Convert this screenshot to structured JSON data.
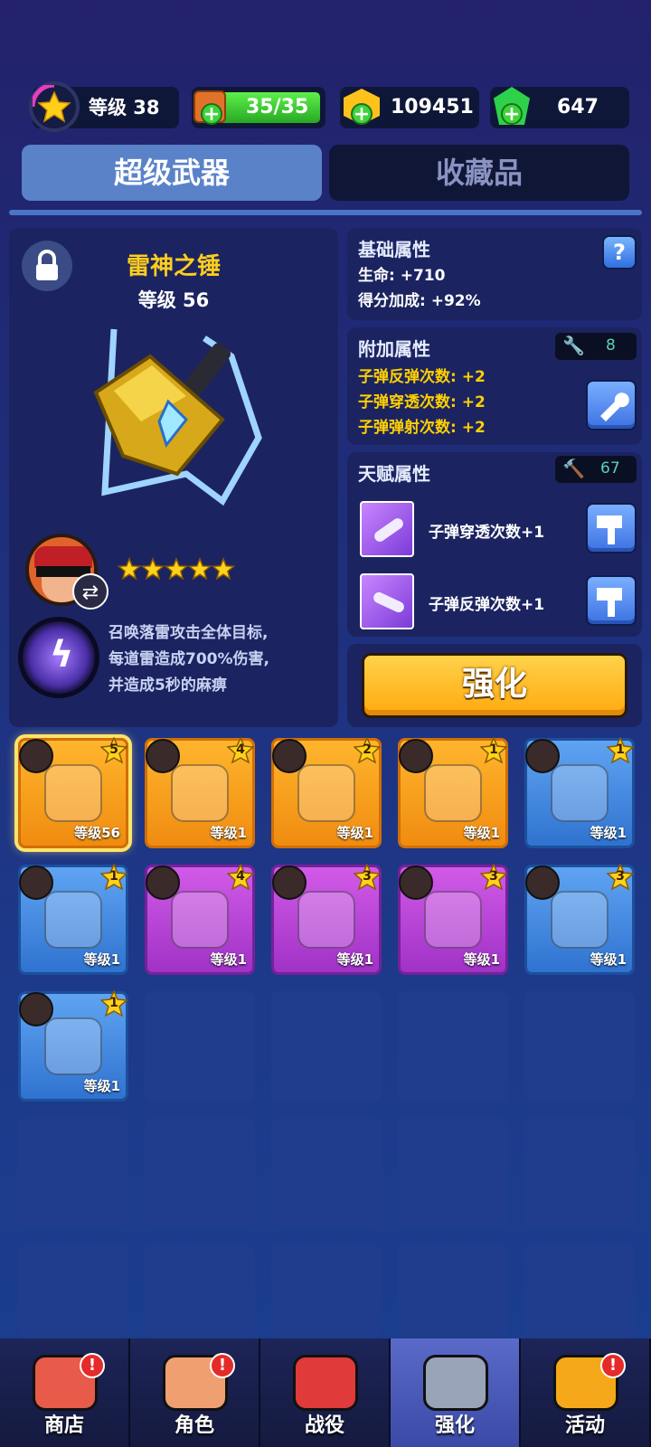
{
  "top_bar": {
    "level_label": "等级 38",
    "energy": "35/35",
    "coins": "109451",
    "gems": "647"
  },
  "tabs": [
    {
      "label": "超级武器",
      "active": true
    },
    {
      "label": "收藏品",
      "active": false
    }
  ],
  "weapon": {
    "name": "雷神之锤",
    "level": "等级 56",
    "stars": 5,
    "skill_desc": "召唤落雷攻击全体目标,\n每道雷造成700%伤害,\n并造成5秒的麻痹"
  },
  "base_attrs": {
    "title": "基础属性",
    "help": "?",
    "lines": [
      "生命: +710",
      "得分加成: +92%"
    ]
  },
  "extra_attrs": {
    "title": "附加属性",
    "wrench_count": "8",
    "lines": [
      "子弹反弹次数: +2",
      "子弹穿透次数: +2",
      "子弹弹射次数: +2"
    ]
  },
  "talent_attrs": {
    "title": "天赋属性",
    "hammer_count": "67",
    "items": [
      "子弹穿透次数+1",
      "子弹反弹次数+1"
    ]
  },
  "upgrade_button": "强化",
  "inventory": [
    {
      "color": "orange",
      "level": "等级56",
      "badge": "5",
      "selected": true
    },
    {
      "color": "orange",
      "level": "等级1",
      "badge": "4"
    },
    {
      "color": "orange",
      "level": "等级1",
      "badge": "2"
    },
    {
      "color": "orange",
      "level": "等级1",
      "badge": "1"
    },
    {
      "color": "blue",
      "level": "等级1",
      "badge": "1"
    },
    {
      "color": "blue",
      "level": "等级1",
      "badge": "1"
    },
    {
      "color": "purple",
      "level": "等级1",
      "badge": "4"
    },
    {
      "color": "purple",
      "level": "等级1",
      "badge": "3"
    },
    {
      "color": "purple",
      "level": "等级1",
      "badge": "3"
    },
    {
      "color": "blue",
      "level": "等级1",
      "badge": "3"
    },
    {
      "color": "blue",
      "level": "等级1",
      "badge": "1"
    }
  ],
  "bottom_nav": [
    {
      "label": "商店",
      "alert": "!"
    },
    {
      "label": "角色",
      "alert": "!"
    },
    {
      "label": "战役",
      "alert": ""
    },
    {
      "label": "强化",
      "alert": ""
    },
    {
      "label": "活动",
      "alert": "!"
    }
  ],
  "colors": {
    "accent_gold": "#ffd000",
    "button_orange": "#ffb52d",
    "energy_green": "#3ed43a"
  }
}
